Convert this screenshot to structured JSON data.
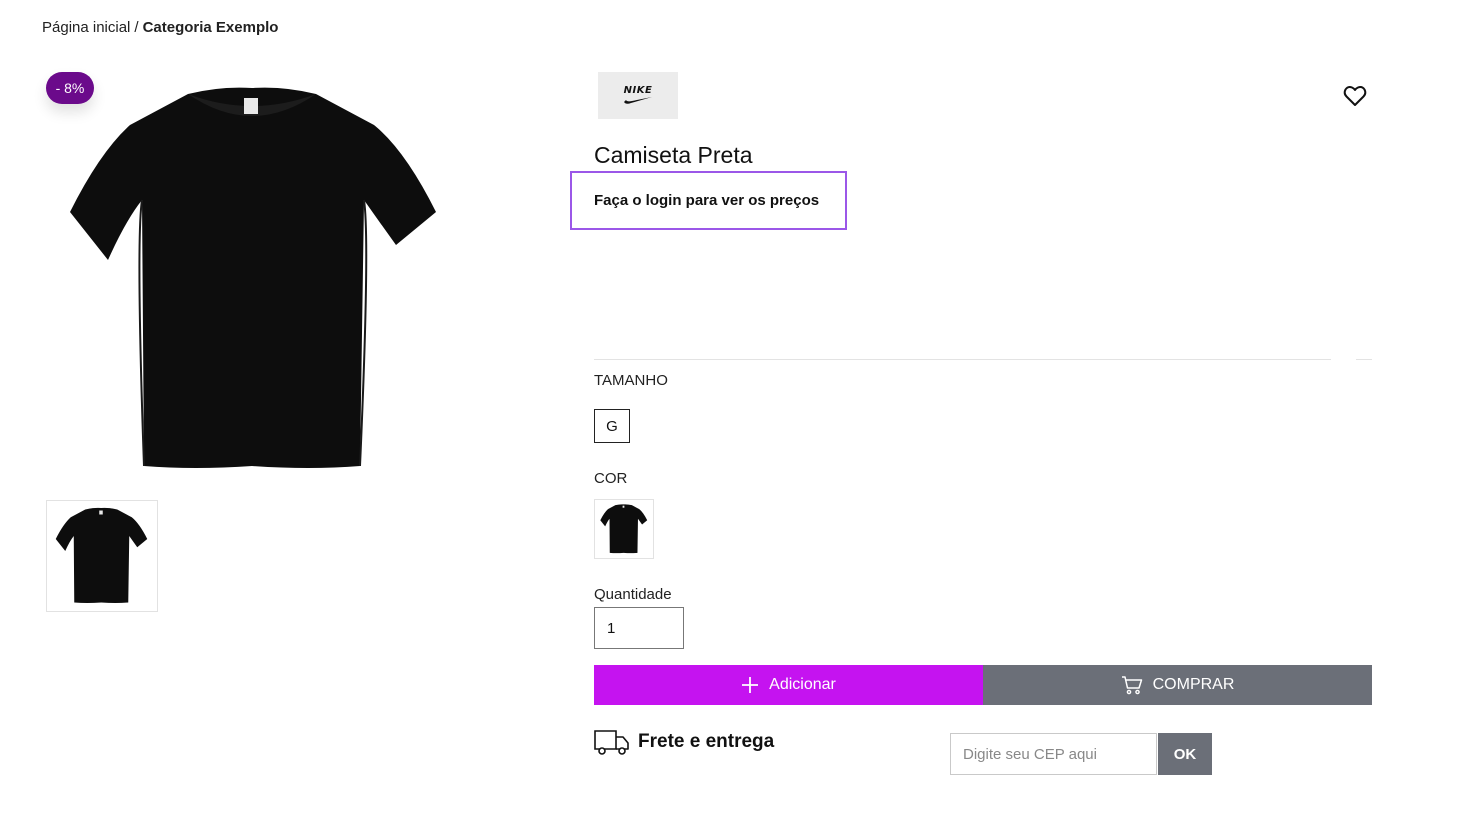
{
  "breadcrumb": {
    "home": "Página inicial",
    "separator": "/",
    "current": "Categoria Exemplo"
  },
  "gallery": {
    "discount_badge": "- 8%",
    "main_image_icon": "tshirt-black-image",
    "thumbnail_icon": "tshirt-black-thumbnail"
  },
  "product": {
    "brand_logo_text": "NIKE",
    "title": "Camiseta Preta",
    "price_notice": "Faça o login para ver os preços",
    "favorite_icon": "heart-outline-icon"
  },
  "options": {
    "size_label": "TAMANHO",
    "sizes": [
      "G"
    ],
    "color_label": "COR",
    "quantity_label": "Quantidade",
    "quantity_value": "1"
  },
  "actions": {
    "add_label": "Adicionar",
    "add_icon": "plus-icon",
    "buy_label": "COMPRAR",
    "buy_icon": "cart-icon"
  },
  "shipping": {
    "title": "Frete e entrega",
    "icon": "truck-icon",
    "cep_placeholder": "Digite seu CEP aqui",
    "ok_label": "OK"
  },
  "colors": {
    "badge": "#6b0a8b",
    "login_border": "#9b57e8",
    "add_button": "#c513f0",
    "buy_button": "#6b6f78"
  }
}
